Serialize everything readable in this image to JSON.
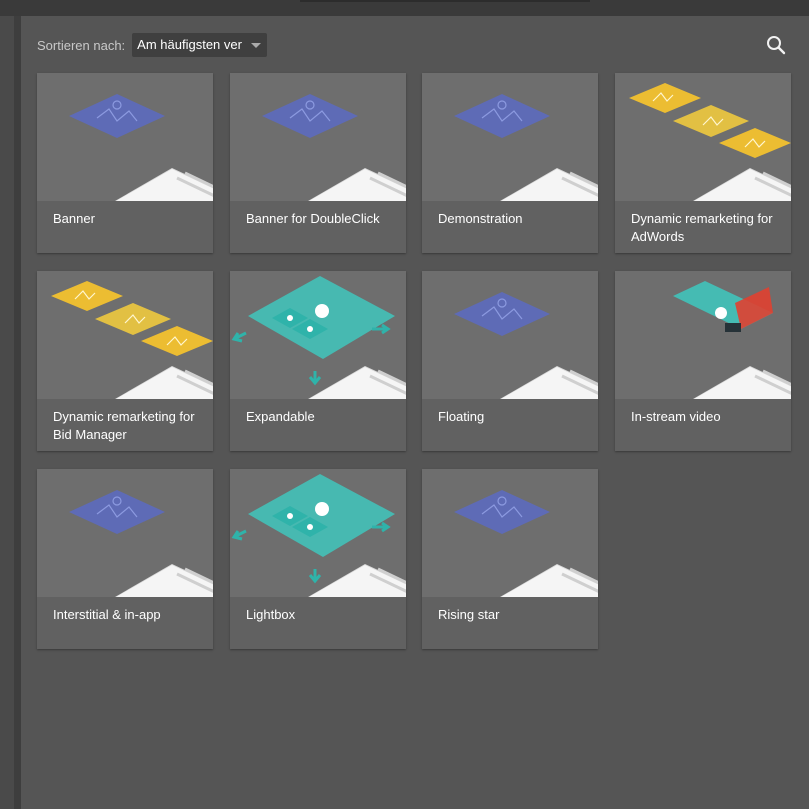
{
  "sort": {
    "label": "Sortieren nach:",
    "selected": "Am häufigsten ver"
  },
  "search": {
    "icon": "search-icon"
  },
  "cards": [
    {
      "title": "Banner",
      "illustration": "blue-panel"
    },
    {
      "title": "Banner for DoubleClick",
      "illustration": "blue-panel"
    },
    {
      "title": "Demonstration",
      "illustration": "blue-panel"
    },
    {
      "title": "Dynamic remarketing for AdWords",
      "illustration": "yellow-carousel"
    },
    {
      "title": "Dynamic remarketing for Bid Manager",
      "illustration": "yellow-carousel"
    },
    {
      "title": "Expandable",
      "illustration": "teal-expand"
    },
    {
      "title": "Floating",
      "illustration": "blue-panel"
    },
    {
      "title": "In-stream video",
      "illustration": "teal-video"
    },
    {
      "title": "Interstitial & in-app",
      "illustration": "blue-panel"
    },
    {
      "title": "Lightbox",
      "illustration": "teal-expand"
    },
    {
      "title": "Rising star",
      "illustration": "blue-panel"
    }
  ],
  "colors": {
    "background": "#555555",
    "card": "#616161",
    "blue": "#5c6bc0",
    "yellow": "#f4c430",
    "teal": "#3ec9c0"
  }
}
